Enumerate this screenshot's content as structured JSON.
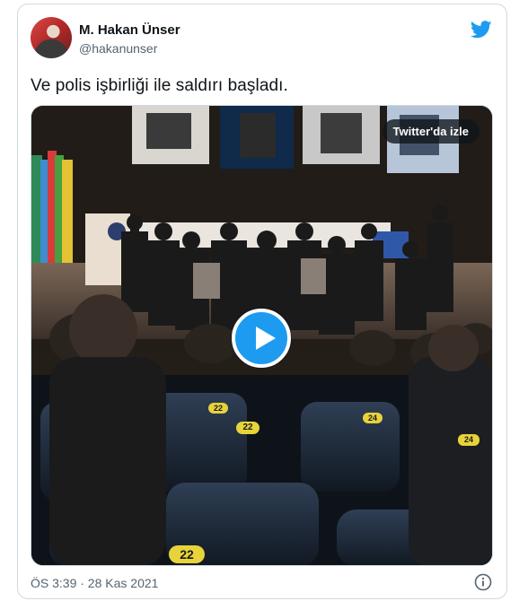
{
  "tweet": {
    "author_name": "M. Hakan Ünser",
    "author_handle": "@hakanunser",
    "text": "Ve polis işbirliği ile saldırı başladı.",
    "timestamp": "ÖS 3:39 · 28 Kas 2021"
  },
  "media": {
    "watch_label": "Twitter'da izle",
    "seat_numbers": [
      "22",
      "22",
      "24",
      "24",
      "22"
    ]
  },
  "icons": {
    "brand": "twitter-bird-icon",
    "play": "play-icon",
    "info": "info-icon"
  },
  "colors": {
    "accent": "#1d9bf0",
    "text": "#0f1419",
    "muted": "#536471",
    "border": "#cfd9de"
  }
}
